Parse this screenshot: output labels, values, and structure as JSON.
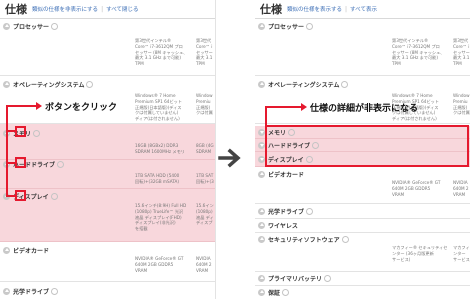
{
  "left": {
    "header": {
      "title": "仕様",
      "link_hide_similar": "類似の仕様を非表示にする",
      "separator": "|",
      "link_collapse_all": "すべて閉じる"
    },
    "rows": {
      "processor": {
        "label": "プロセッサー",
        "col1": "第3世代インテル®\nCore™ i7-3612QM プロ\nセッサー (8M キャッシュ、\n最大 3.1 GHz まで可能)\nTPM",
        "col2": "第3世代\nCore™ i\nセッサー\n最大 3.1\nTPM"
      },
      "os": {
        "label": "オペレーティングシステム",
        "col1": "Windows® 7 Home\nPremium SP1 64ビット\n正規版(日本語版)(ディス\nクは付属していません)\nディア(は付されません)",
        "col2": "Window\nPremiu\n正規版(\nクは付属"
      },
      "memory": {
        "label": "メモリ",
        "col1": "16GB (8GBx2) DDR3\nSDRAM 1600MHz メモリ",
        "col2": "8GB (4G\nSDRAM"
      },
      "harddrive": {
        "label": "ハードドライブ",
        "col1": "1TB SATA HDD (5400\n回転)+(32GB mSATA)",
        "col2": "1TB SAT\n回転)+(3"
      },
      "display": {
        "label": "ディスプレイ",
        "col1": "15.6インチ(8:9H) Full HD\n(1080p) TrueLife™ 光沢\n液晶 ディスプレイ(FHD)\nディスプレイ(非光沢)\nを搭載",
        "col2": "15.6イン\n(1080p)\n液晶 ディ\nディスプ"
      },
      "videocard": {
        "label": "ビデオカード",
        "col1": "NVIDIA® GeForce® GT\n640M 2GB GDDR5\nVRAM",
        "col2": "NVIDIA\n640M 2\nVRAM"
      },
      "optical": {
        "label": "光学ドライブ"
      }
    },
    "annotation": {
      "text": "ボタンをクリック"
    }
  },
  "right": {
    "header": {
      "title": "仕様",
      "link_show_similar": "類似の仕様を表示する",
      "separator": "|",
      "link_show_all": "すべて表示"
    },
    "rows": {
      "processor": {
        "label": "プロセッサー",
        "col1": "第3世代インテル®\nCore™ i7-3612QM プロ\nセッサー (8M キャッシュ、\n最大 3.1 GHz まで可能)\nTPM",
        "col2": "第3世代\nCore™ i\nセッサー\n最大 3.1\nTPM"
      },
      "os": {
        "label": "オペレーティングシステム",
        "col1": "Windows® 7 Home\nPremium SP1 64ビット\n正規版(日本語版)(ディス\nクは付属していません)\nディア(は付されません)",
        "col2": "Window\nPremiu\n正規版(\nクは付属"
      },
      "memory": {
        "label": "メモリ"
      },
      "harddrive": {
        "label": "ハードドライブ"
      },
      "display": {
        "label": "ディスプレイ"
      },
      "videocard": {
        "label": "ビデオカード",
        "col1": "NVIDIA® GeForce® GT\n640M 2GB GDDR5\nVRAM",
        "col2": "NVIDIA\n640M 2\nVRAM"
      },
      "optical": {
        "label": "光学ドライブ"
      },
      "wireless": {
        "label": "ワイヤレス"
      },
      "security": {
        "label": "セキュリティソフトウェア",
        "col1": "マカフィー® セキュリティセ\nンター (36ヶ月版更新\nサービス)",
        "col2": "マカフィ\nンター\nサービス"
      },
      "battery": {
        "label": "プライマリバッテリ"
      },
      "warranty": {
        "label": "保証"
      }
    },
    "annotation": {
      "text": "仕様の詳細が非表示になる"
    }
  },
  "colors": {
    "annotation_red": "#e5192e",
    "highlight_pink": "#f8d7dc",
    "link_blue": "#3a6db5"
  }
}
